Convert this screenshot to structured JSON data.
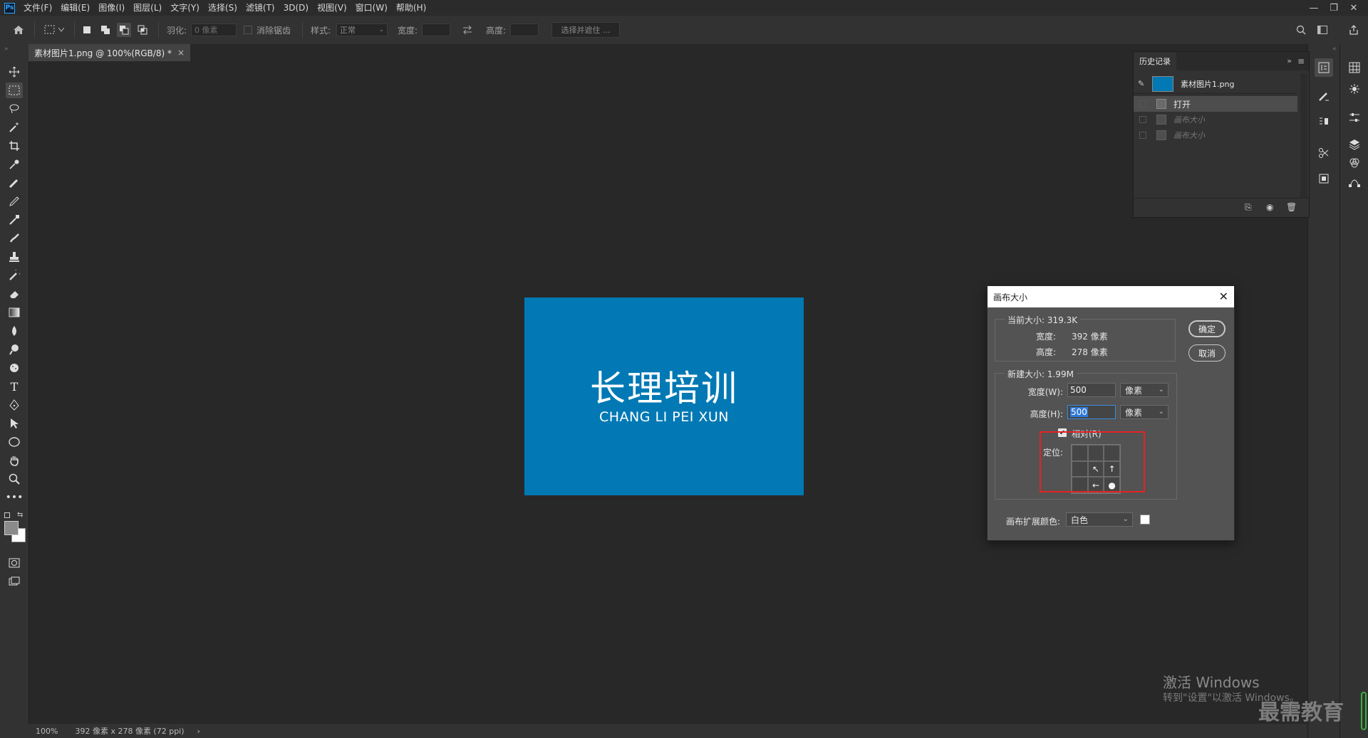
{
  "app": {
    "logo": "Ps"
  },
  "menu": [
    "文件(F)",
    "编辑(E)",
    "图像(I)",
    "图层(L)",
    "文字(Y)",
    "选择(S)",
    "滤镜(T)",
    "3D(D)",
    "视图(V)",
    "窗口(W)",
    "帮助(H)"
  ],
  "window_controls": {
    "minimize": "—",
    "restore": "❐",
    "close": "✕"
  },
  "options": {
    "feather_label": "羽化:",
    "feather_value": "0 像素",
    "antialias_label": "消除锯齿",
    "style_label": "样式:",
    "style_value": "正常",
    "width_label": "宽度:",
    "height_label": "高度:",
    "select_mask": "选择并遮住 ..."
  },
  "document": {
    "tab_title": "素材图片1.png @ 100%(RGB/8) *",
    "close": "×"
  },
  "canvas": {
    "text_cn": "长理培训",
    "text_en": "CHANG LI PEI XUN",
    "bg_color": "#0279b4"
  },
  "status": {
    "zoom": "100%",
    "info": "392 像素 x 278 像素 (72 ppi)",
    "arrow": "›"
  },
  "history": {
    "title": "历史记录",
    "snapshot": "素材图片1.png",
    "items": [
      {
        "label": "打开",
        "selected": true
      },
      {
        "label": "画布大小",
        "selected": false
      },
      {
        "label": "画布大小",
        "selected": false
      }
    ]
  },
  "dialog": {
    "title": "画布大小",
    "current_size": "当前大小: 319.3K",
    "width_label": "宽度:",
    "width_value": "392 像素",
    "height_label": "高度:",
    "height_value": "278 像素",
    "new_size": "新建大小: 1.99M",
    "new_width_label": "宽度(W):",
    "new_width_value": "500",
    "new_height_label": "高度(H):",
    "new_height_value": "500",
    "unit": "像素",
    "relative_label": "相对(R)",
    "anchor_label": "定位:",
    "extend_label": "画布扩展颜色:",
    "extend_value": "白色",
    "ok": "确定",
    "cancel": "取消"
  },
  "watermark": {
    "line1": "激活 Windows",
    "line2": "转到\"设置\"以激活 Windows。",
    "brand": "最需教育"
  }
}
